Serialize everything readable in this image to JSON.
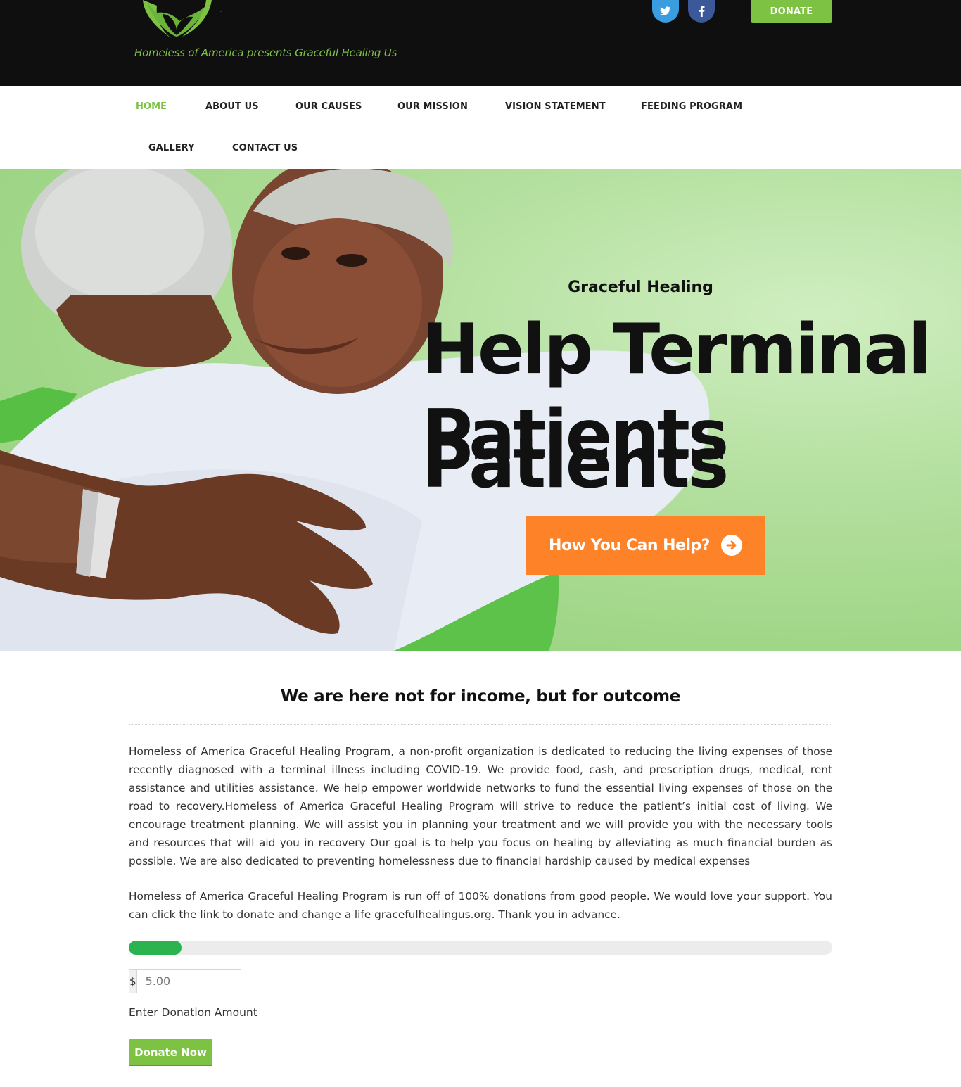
{
  "header": {
    "tagline": "Homeless of America presents Graceful Healing Us",
    "donate_label": "DONATE",
    "social": [
      {
        "icon": "twitter-icon",
        "color": "#3a9de0"
      },
      {
        "icon": "facebook-icon",
        "color": "#3b5998"
      }
    ],
    "accent_color": "#7dc242"
  },
  "nav": {
    "items": [
      {
        "label": "HOME",
        "active": true
      },
      {
        "label": "ABOUT US"
      },
      {
        "label": "OUR CAUSES"
      },
      {
        "label": "OUR MISSION"
      },
      {
        "label": "VISION STATEMENT"
      },
      {
        "label": "FEEDING PROGRAM"
      },
      {
        "label": "GALLERY"
      },
      {
        "label": "CONTACT US"
      }
    ]
  },
  "hero": {
    "subtitle": "Graceful Healing",
    "title_line1": "Help Terminal",
    "title_line2": "Patients",
    "cta_label": "How You Can Help?",
    "cta_color": "#fe8228"
  },
  "content": {
    "title": "We are here not for income, but for outcome",
    "paragraph1": "Homeless of America Graceful Healing Program, a non-profit organization is dedicated to reducing the living expenses of those recently diagnosed with a terminal illness including COVID-19. We provide food, cash, and prescription drugs, medical, rent assistance and utilities assistance. We help empower worldwide networks to fund the essential living expenses of those on the road to recovery.Homeless of America Graceful Healing Program will strive to reduce the patient’s initial cost of living. We encourage treatment planning. We will assist you in planning your treatment and we will provide you with the necessary tools and resources that will aid you in recovery Our goal is to help you focus on healing by alleviating as much financial burden as possible. We are also dedicated to preventing homelessness due to financial hardship caused by medical expenses",
    "paragraph2": "Homeless of America Graceful Healing Program is run off of 100% donations from good people. We would love your support. You can click the link to donate and change a life gracefulhealingus.org. Thank you in advance."
  },
  "donation": {
    "progress_fraction": 0.075,
    "progress_color": "#2bb34f",
    "currency_symbol": "$",
    "amount_placeholder": "5.00",
    "amount_label": "Enter Donation Amount",
    "button_label": "Donate Now"
  }
}
